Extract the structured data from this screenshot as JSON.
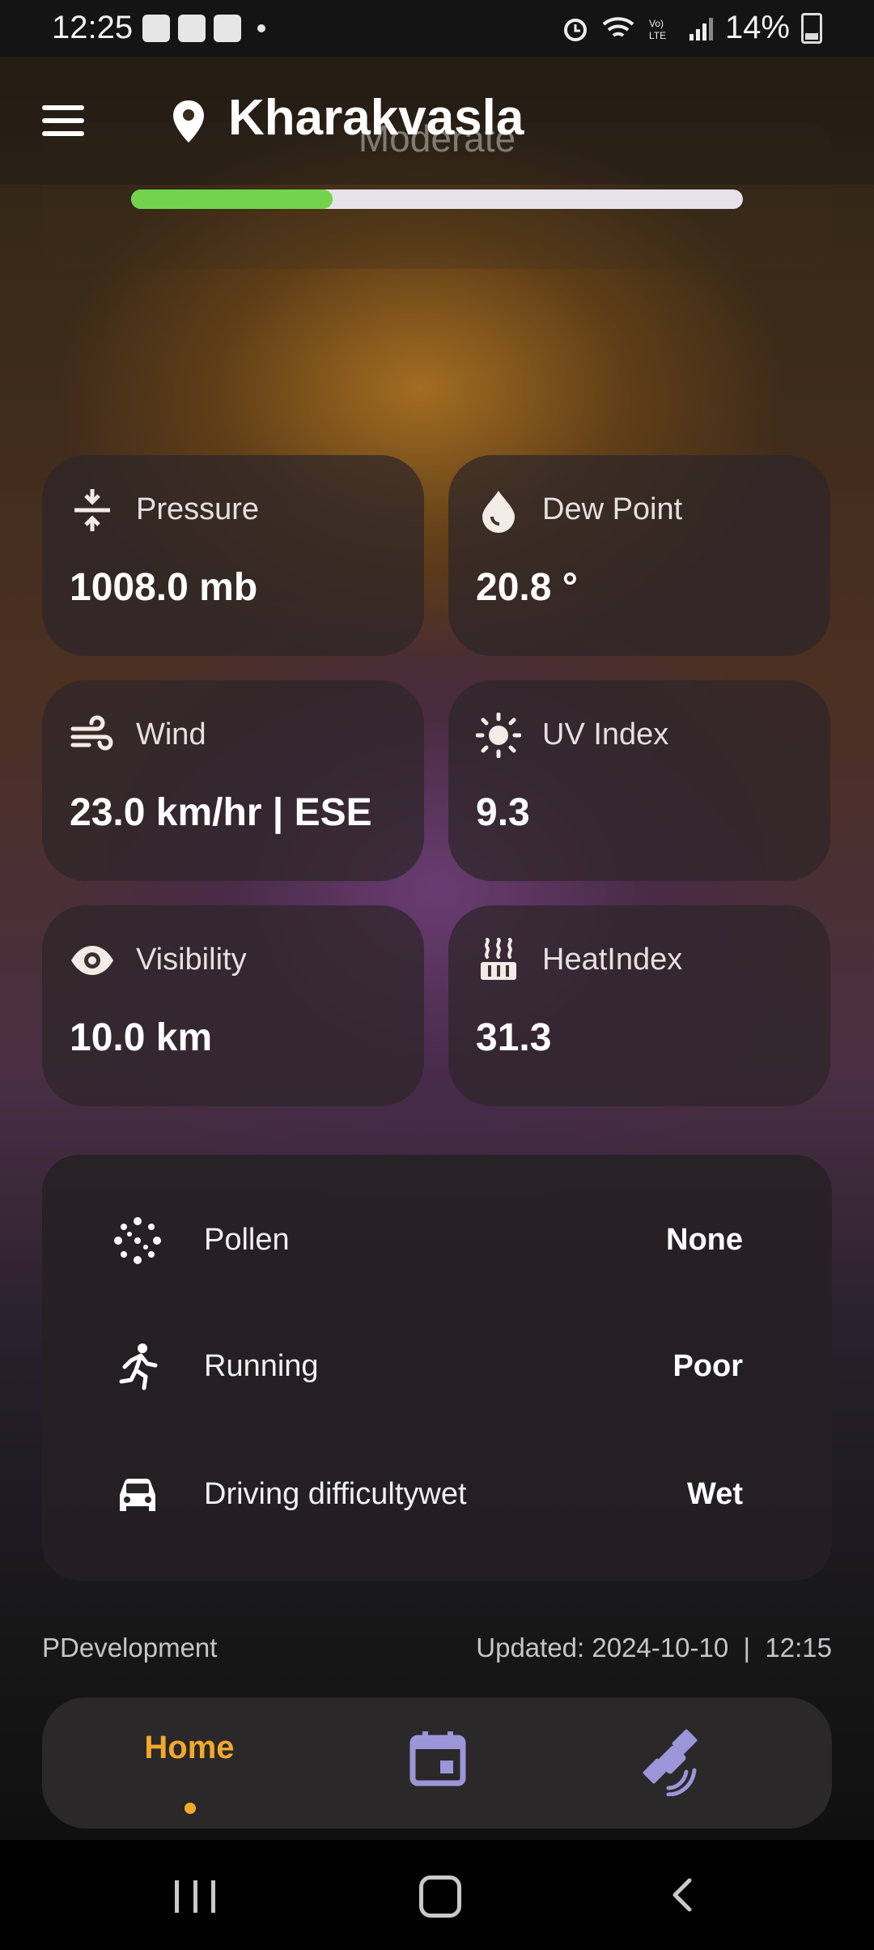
{
  "status_bar": {
    "time": "12:25",
    "battery": "14%"
  },
  "header": {
    "location": "Kharakvasla"
  },
  "air_quality": {
    "label": "Moderate",
    "level_fraction": 0.33
  },
  "tiles": {
    "pressure": {
      "label": "Pressure",
      "value": "1008.0 mb"
    },
    "dew_point": {
      "label": "Dew Point",
      "value": "20.8 °"
    },
    "wind": {
      "label": "Wind",
      "value": "23.0 km/hr | ESE"
    },
    "uv_index": {
      "label": "UV Index",
      "value": "9.3"
    },
    "visibility": {
      "label": "Visibility",
      "value": "10.0 km"
    },
    "heat_index": {
      "label": "HeatIndex",
      "value": "31.3"
    }
  },
  "activities": [
    {
      "label": "Pollen",
      "value": "None",
      "icon": "pollen-icon"
    },
    {
      "label": "Running",
      "value": "Poor",
      "icon": "running-icon"
    },
    {
      "label": "Driving difficultywet",
      "value": "Wet",
      "icon": "car-icon"
    }
  ],
  "footer": {
    "developer": "PDevelopment",
    "updated": "Updated: 2024-10-10  |  12:15"
  },
  "bottom_nav": {
    "home_label": "Home"
  },
  "colors": {
    "accent": "#f2a92a",
    "aqi_fill": "#72d44c",
    "nav_icon": "#9a96d8"
  }
}
